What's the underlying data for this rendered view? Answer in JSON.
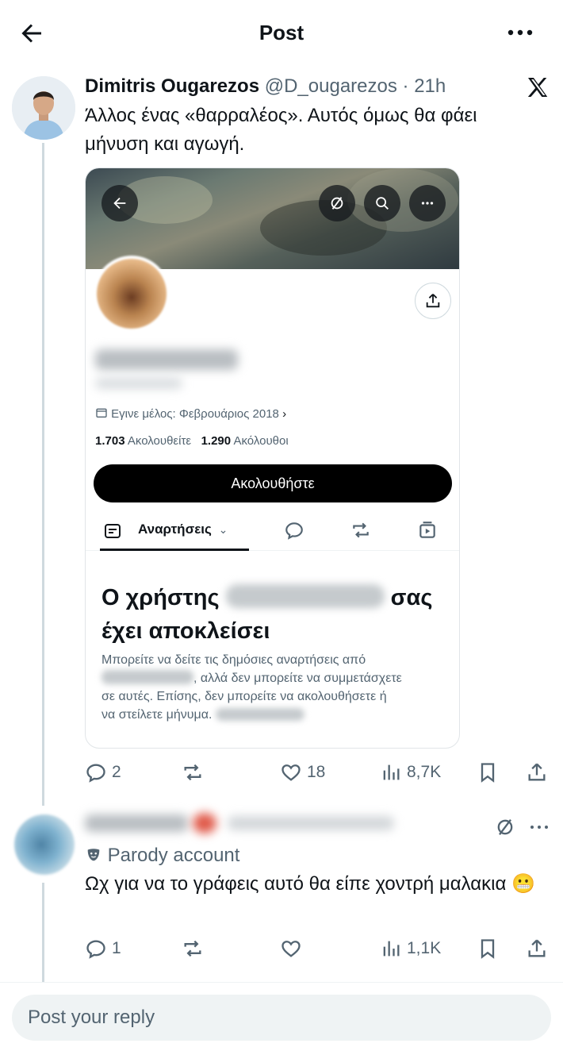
{
  "topbar": {
    "title": "Post"
  },
  "post": {
    "author_name": "Dimitris Ougarezos",
    "handle": "@D_ougarezos",
    "separator": "·",
    "time": "21h",
    "text": "Άλλος ένας «θαρραλέος». Αυτός όμως θα φάει μήνυση και αγωγή.",
    "embed": {
      "joined": "Εγινε μέλος: Φεβρουάριος 2018",
      "following_count": "1.703",
      "following_label": "Ακολουθείτε",
      "followers_count": "1.290",
      "followers_label": "Ακόλουθοι",
      "follow_button": "Ακολουθήστε",
      "tab_posts": "Αναρτήσεις",
      "blocked_title_part1": "Ο χρήστης",
      "blocked_title_part2": "σας",
      "blocked_title_part3": "έχει αποκλείσει",
      "blocked_body_line1": "Μπορείτε να δείτε τις δημόσιες αναρτήσεις από",
      "blocked_body_line2": ", αλλά δεν μπορείτε να συμμετάσχετε",
      "blocked_body_line3": "σε αυτές. Επίσης, δεν μπορείτε να ακολουθήσετε ή",
      "blocked_body_line4": "να στείλετε μήνυμα."
    },
    "stats": {
      "replies": "2",
      "retweets": "",
      "likes": "18",
      "views": "8,7K"
    }
  },
  "reply": {
    "parody_label": "Parody account",
    "text": "Ωχ για να το γράφεις αυτό θα είπε χοντρή μαλακια 😬",
    "stats": {
      "replies": "1",
      "retweets": "",
      "likes": "",
      "views": "1,1K"
    }
  },
  "composer": {
    "placeholder": "Post your reply"
  },
  "colors": {
    "text": "#0f1419",
    "secondary": "#536471",
    "divider": "#eff3f4"
  }
}
